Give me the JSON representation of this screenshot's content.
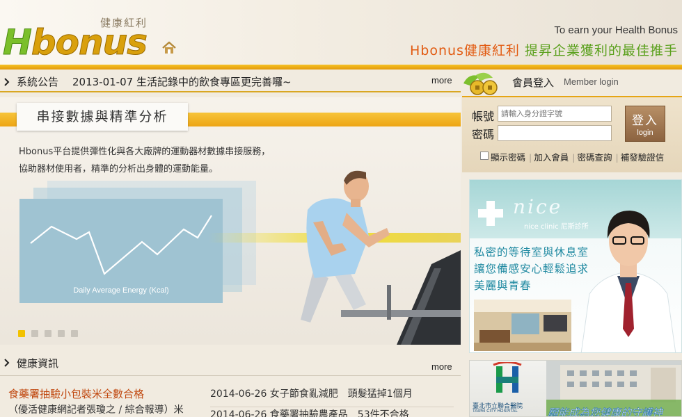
{
  "header": {
    "logo_text": "Hbonus",
    "logo_sub": "健康紅利",
    "tagline_en": "To earn your Health Bonus",
    "tagline_brand": "Hbonus健康紅利",
    "tagline_slogan": "提昇企業獲利的最佳推手",
    "colors": {
      "accent": "#e39a0a",
      "brand_orange": "#e25a10",
      "brand_green": "#5aa01c"
    }
  },
  "ticker": {
    "label": "系統公告",
    "text": "2013-01-07 生活記錄中的飲食專區更完善囉~",
    "more": "more"
  },
  "hero": {
    "tab_title": "串接數據與精準分析",
    "desc_line1": "Hbonus平台提供彈性化與各大廠牌的運動器材數據串接服務，",
    "desc_line2": "協助器材使用者，精準的分析出身體的運動能量。",
    "chart_label": "Daily Average Energy (Kcal)",
    "slides": 5,
    "active_slide": 1
  },
  "health": {
    "title": "健康資訊",
    "more": "more",
    "headline": "食藥署抽驗小包裝米全數合格",
    "headline_sub": "（優活健康網記者張瓊之 / 綜合報導）米",
    "items": [
      "2014-06-26 女子節食亂減肥　頭髮猛掉1個月",
      "2014-06-26 食藥署抽驗農產品　53件不合格"
    ]
  },
  "login": {
    "title": "會員登入",
    "title_en": "Member login",
    "user_label": "帳號",
    "user_placeholder": "請輸入身分證字號",
    "pass_label": "密碼",
    "button_zh": "登入",
    "button_en": "login",
    "show_password": "顯示密碼",
    "join": "加入會員",
    "forgot": "密碼查詢",
    "resend": "補發驗證信"
  },
  "ad_nice": {
    "brand": "nice",
    "sub": "nice clinic 尼斯診所",
    "line1": "私密的等待室與休息室",
    "line2": "讓您備感安心輕鬆追求",
    "line3": "美麗與青春"
  },
  "ad_hospital": {
    "name": "臺北市立聯合醫院",
    "name_en": "TAIPEI CITY HOSPITAL",
    "slogan": "願能成為您健康的守護神"
  }
}
